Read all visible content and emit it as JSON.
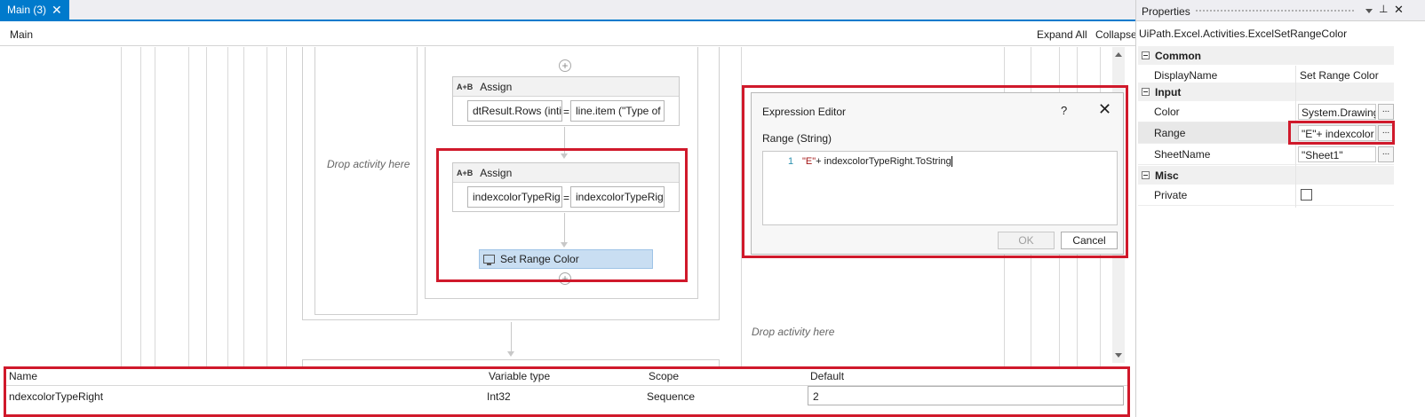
{
  "tab": {
    "label": "Main (3)",
    "close": "✕"
  },
  "breadcrumb": "Main",
  "toolbar": {
    "expand_all": "Expand All",
    "collapse_all": "Collapse All"
  },
  "canvas": {
    "drop_left": "Drop activity here",
    "drop_right": "Drop activity here",
    "assign1": {
      "title": "Assign",
      "icon": "A+B",
      "to": "dtResult.Rows (inti",
      "value": "line.item (\"Type of",
      "eq": "="
    },
    "assign2": {
      "title": "Assign",
      "icon": "A+B",
      "to": "indexcolorTypeRig",
      "value": "indexcolorTypeRig",
      "eq": "="
    },
    "set_range": {
      "title": "Set Range Color"
    }
  },
  "dialog": {
    "title": "Expression Editor",
    "help": "?",
    "close": "✕",
    "label": "Range (String)",
    "line_number": "1",
    "code_string": "\"E\"",
    "code_rest": "+ indexcolorTypeRight.ToString",
    "ok": "OK",
    "cancel": "Cancel"
  },
  "variables": {
    "headers": {
      "name": "Name",
      "type": "Variable type",
      "scope": "Scope",
      "default": "Default"
    },
    "row": {
      "name": "ndexcolorTypeRight",
      "type": "Int32",
      "scope": "Sequence",
      "default": "2"
    }
  },
  "properties": {
    "title": "Properties",
    "class_name": "UiPath.Excel.Activities.ExcelSetRangeColor",
    "categories": {
      "common": "Common",
      "input": "Input",
      "misc": "Misc"
    },
    "display_name": {
      "label": "DisplayName",
      "value": "Set Range Color"
    },
    "color": {
      "label": "Color",
      "value": "System.Drawing"
    },
    "range": {
      "label": "Range",
      "value": "\"E\"+ indexcolor"
    },
    "sheet_name": {
      "label": "SheetName",
      "value": "\"Sheet1\""
    },
    "private": {
      "label": "Private",
      "checked": false
    },
    "ellipsis": "..."
  },
  "colors": {
    "accent": "#007acc",
    "highlight": "#d0192b",
    "selected_activity": "#c9def2"
  }
}
